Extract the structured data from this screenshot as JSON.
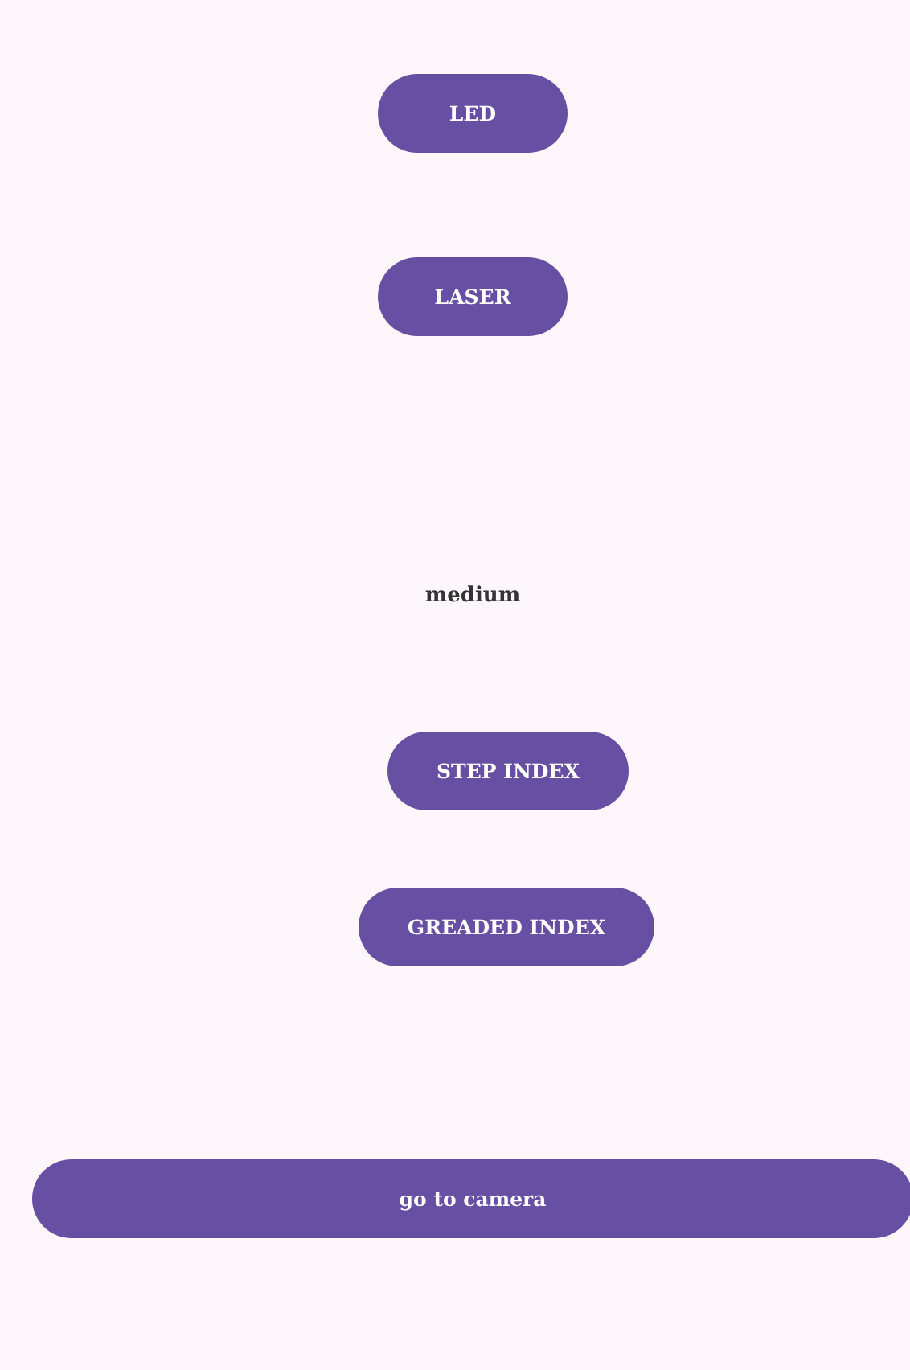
{
  "source_buttons": [
    "LED",
    "LASER"
  ],
  "medium_label": "medium",
  "fiber_buttons": [
    "STEP INDEX",
    "GREADED INDEX"
  ],
  "camera_button": "go to camera"
}
